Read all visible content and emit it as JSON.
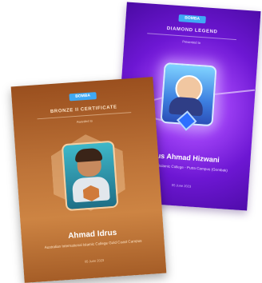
{
  "certificates": [
    {
      "logo": "BOMBA",
      "title": "DIAMOND LEGEND",
      "awarded_to": "Presented to",
      "name": "Idrus Ahmad Hizwani",
      "school": "International Islamic College - Putra Campus (Gombak)",
      "date": "05 June 2023",
      "colors": {
        "background": "#7a1fe0",
        "accent": "#d7ecff"
      },
      "emblem_icon": "diamond-gem-icon"
    },
    {
      "logo": "BOMBA",
      "title": "BRONZE II CERTIFICATE",
      "awarded_to": "Awarded to",
      "name": "Ahmad Idrus",
      "school": "Australian International Islamic College Gold Coast Campus",
      "date": "05 June 2023",
      "colors": {
        "background": "#b86c33",
        "accent": "#f6cfa2"
      },
      "emblem_icon": "hexagon-badge-icon"
    }
  ]
}
